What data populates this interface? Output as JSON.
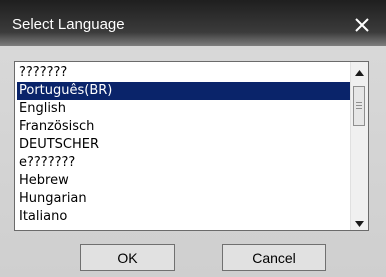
{
  "dialog": {
    "title": "Select Language",
    "close_icon": "close-icon"
  },
  "language_list": {
    "items": [
      {
        "label": "???????",
        "selected": false
      },
      {
        "label": "Português(BR)",
        "selected": true
      },
      {
        "label": "English",
        "selected": false
      },
      {
        "label": "Französisch",
        "selected": false
      },
      {
        "label": "DEUTSCHER",
        "selected": false
      },
      {
        "label": "e???????",
        "selected": false
      },
      {
        "label": "Hebrew",
        "selected": false
      },
      {
        "label": "Hungarian",
        "selected": false
      },
      {
        "label": "Italiano",
        "selected": false
      }
    ]
  },
  "buttons": {
    "ok_label": "OK",
    "cancel_label": "Cancel"
  },
  "colors": {
    "selection": "#0a246a",
    "titlebar": "#1f1f1f"
  }
}
